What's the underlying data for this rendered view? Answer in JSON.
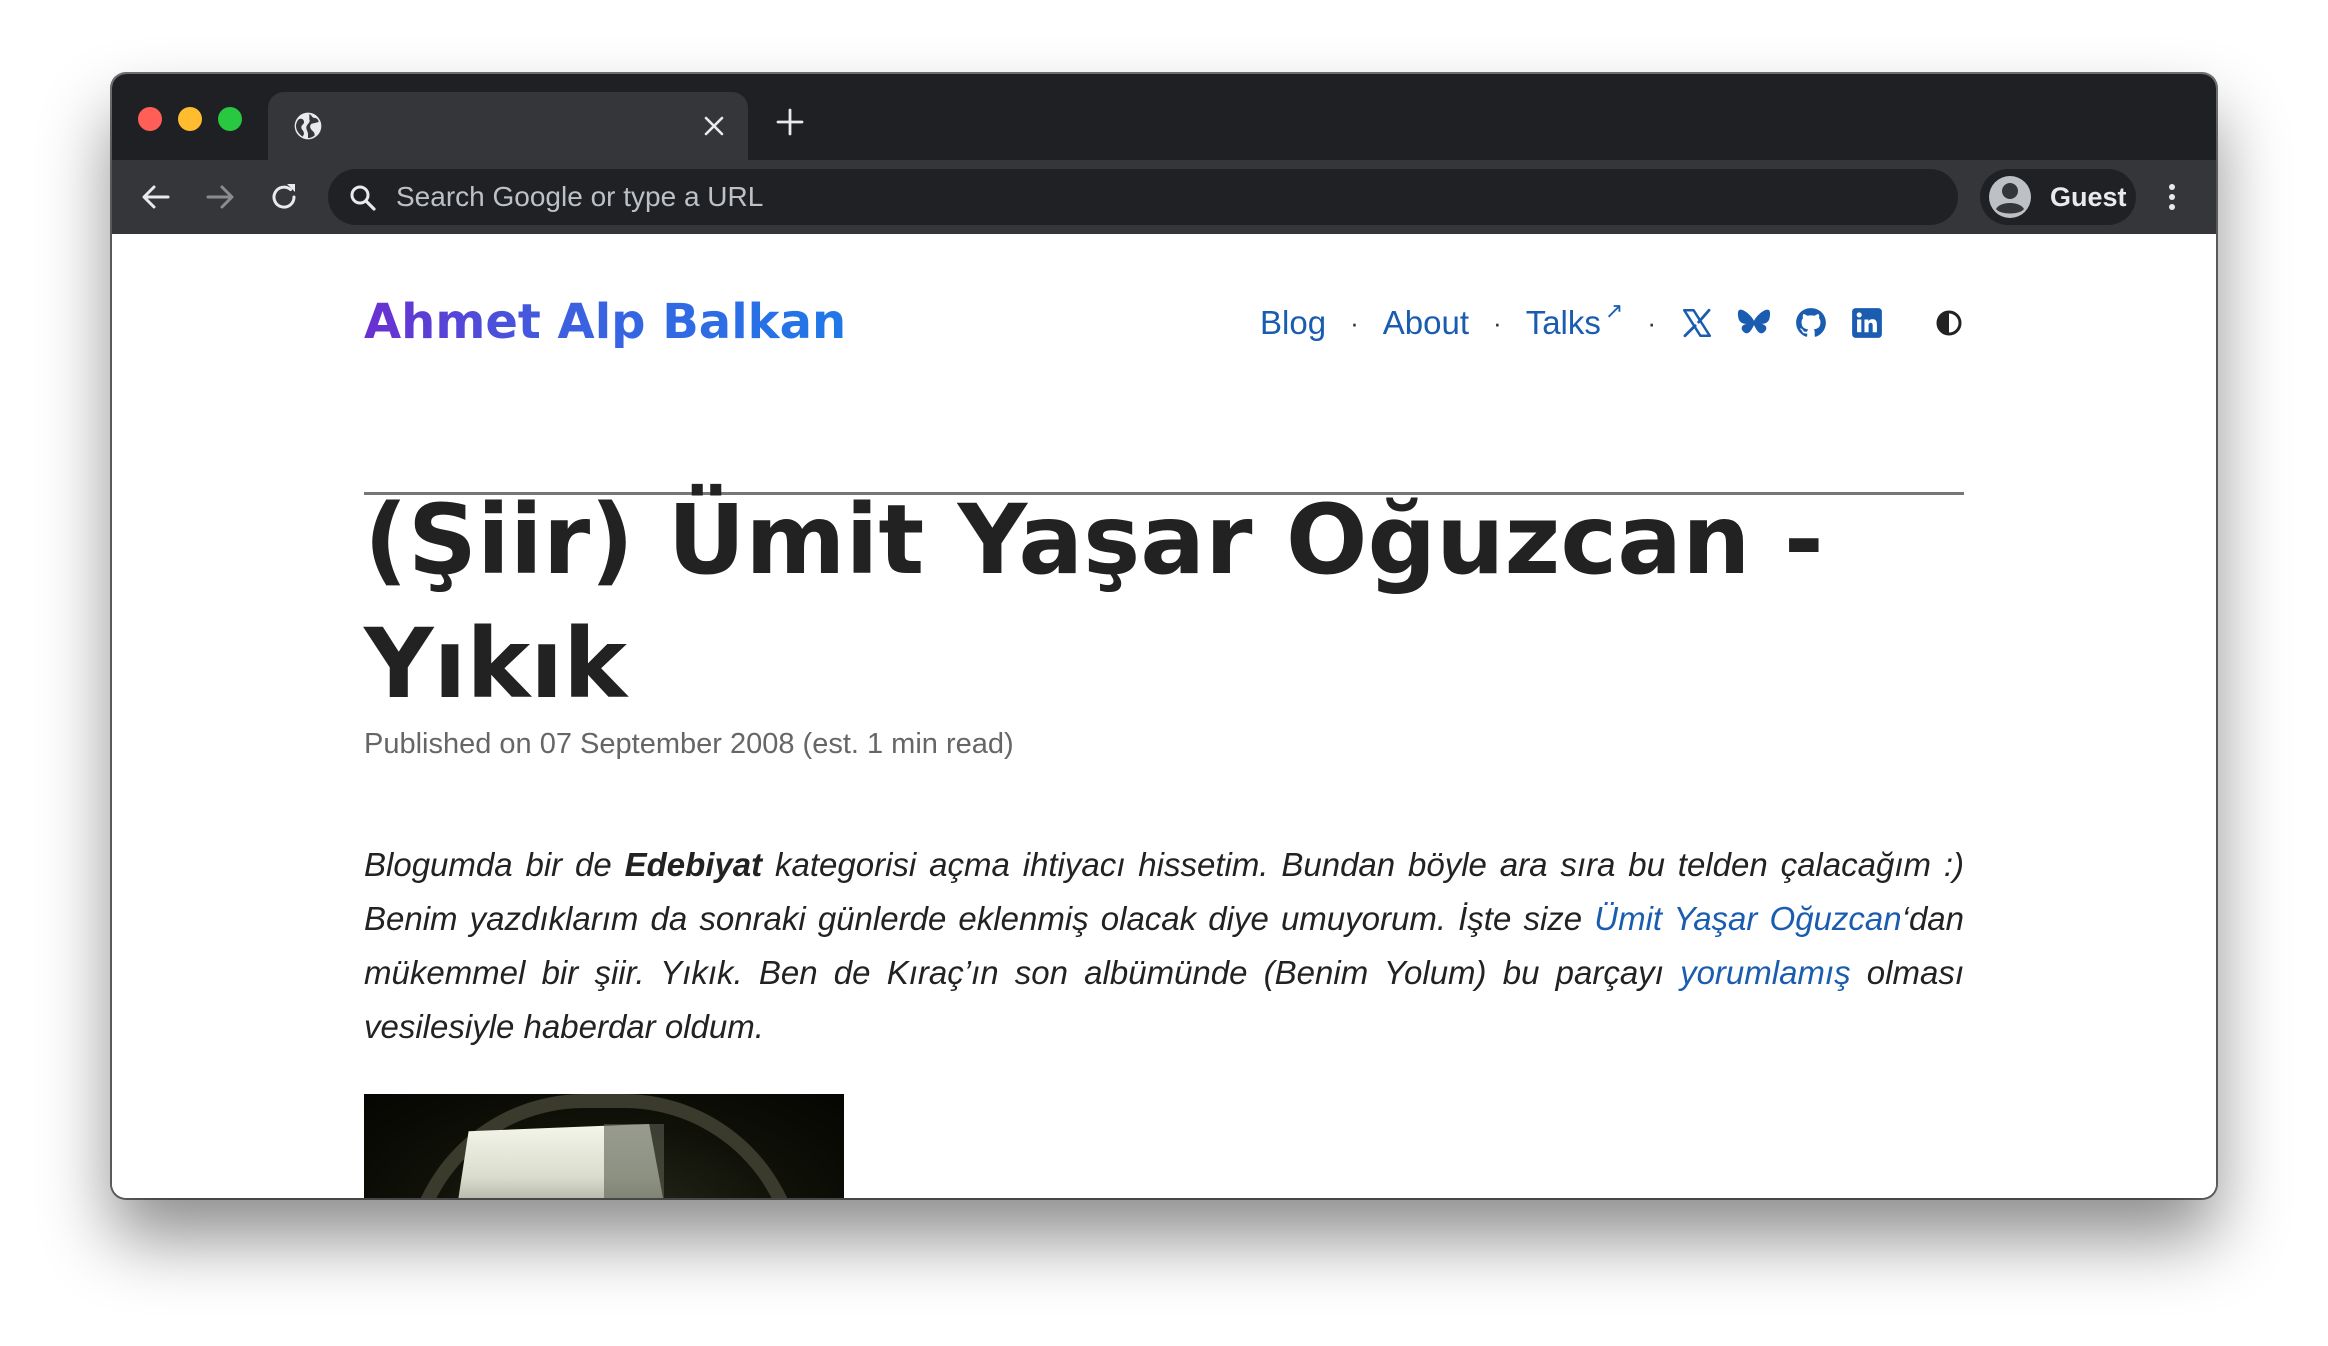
{
  "browser": {
    "omnibox_placeholder": "Search Google or type a URL",
    "profile_label": "Guest",
    "colors": {
      "titlebar": "#1f2023",
      "toolbar": "#35363a",
      "omnibox": "#202124"
    }
  },
  "site": {
    "title": "Ahmet Alp Balkan",
    "nav": {
      "blog": "Blog",
      "about": "About",
      "talks": "Talks",
      "talks_ext_icon": "↗",
      "separator": "·"
    },
    "social_icons": [
      "x-icon",
      "bluesky-icon",
      "github-icon",
      "linkedin-icon"
    ],
    "theme_toggle_icon": "contrast-icon",
    "link_color": "#1a5cb0"
  },
  "post": {
    "title": "(Şiir) Ümit Yaşar Oğuzcan - Yıkık",
    "meta": "Published on 07 September 2008 (est. 1 min read)",
    "intro": {
      "p1": "Blogumda bir de ",
      "bold": "Edebiyat",
      "p2": " kategorisi açma ihtiyacı hissetim. Bundan böyle ara sıra bu telden çalacağım :) Benim yazdıklarım da sonraki günlerde eklenmiş olacak diye umuyorum. İşte size ",
      "link1": "Ümit Yaşar Oğuzcan",
      "p3": "‘dan mükemmel bir şiir. Yıkık. Ben de Kıraç’ın son albümünde (Benim Yolum) bu parçayı ",
      "link2": "yorumlamış",
      "p4": " olması vesilesiyle haberdar oldum."
    }
  }
}
